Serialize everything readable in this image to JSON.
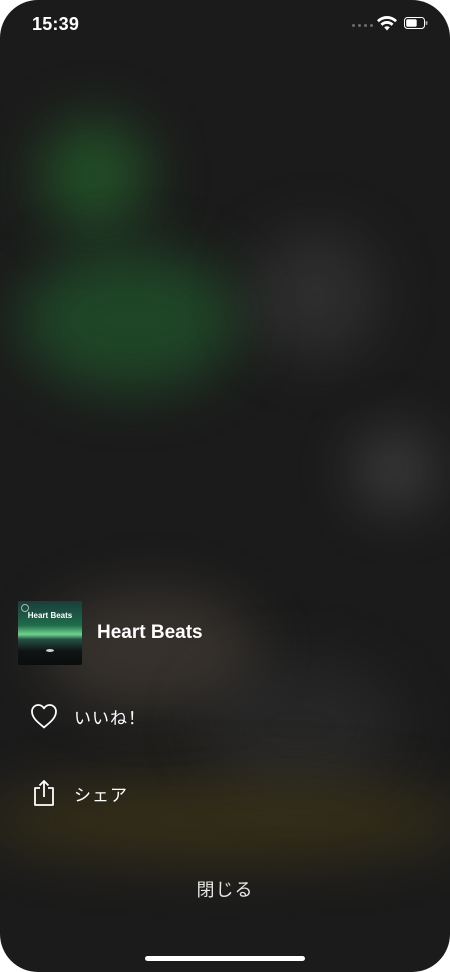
{
  "status_bar": {
    "time": "15:39",
    "signal_icon": "signal-dots-icon",
    "wifi_icon": "wifi-icon",
    "battery_icon": "battery-icon"
  },
  "track": {
    "title": "Heart Beats",
    "artwork_title": "Heart Beats",
    "artwork_icon": "album-artwork"
  },
  "actions": [
    {
      "label": "いいね！",
      "icon": "heart-icon"
    },
    {
      "label": "シェア",
      "icon": "share-icon"
    }
  ],
  "close_label": "閉じる",
  "colors": {
    "background": "#1b1b1b",
    "text": "#ffffff",
    "green_blur": "#2b7a3a",
    "gold_blur": "#6e5a14"
  }
}
